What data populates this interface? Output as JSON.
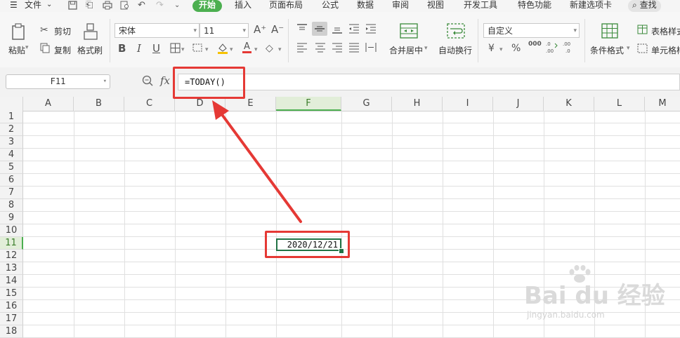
{
  "menubar": {
    "menu_icon": "hamburger-icon",
    "file_label": "文件",
    "tabs": [
      {
        "label": "开始",
        "active": true
      },
      {
        "label": "插入"
      },
      {
        "label": "页面布局"
      },
      {
        "label": "公式"
      },
      {
        "label": "数据"
      },
      {
        "label": "审阅"
      },
      {
        "label": "视图"
      },
      {
        "label": "开发工具"
      },
      {
        "label": "特色功能"
      },
      {
        "label": "新建选项卡"
      }
    ],
    "search_label": "查找"
  },
  "ribbon": {
    "paste_label": "粘贴",
    "cut_label": "剪切",
    "copy_label": "复制",
    "format_painter_label": "格式刷",
    "font_name": "宋体",
    "font_size": "11",
    "bold": "B",
    "italic": "I",
    "underline": "U",
    "merge_center_label": "合并居中",
    "wrap_text_label": "自动换行",
    "number_format": "自定义",
    "currency_symbol": "¥",
    "percent_symbol": "%",
    "thousands_symbol": "000",
    "conditional_format_label": "条件格式",
    "table_style_label": "表格样式",
    "cell_style_label": "单元格样式"
  },
  "formula_bar": {
    "name_box": "F11",
    "fx_label": "fx",
    "formula": "=TODAY()"
  },
  "sheet": {
    "columns": [
      "A",
      "B",
      "C",
      "D",
      "E",
      "F",
      "G",
      "H",
      "I",
      "J",
      "K",
      "L",
      "M"
    ],
    "rows": [
      "1",
      "2",
      "3",
      "4",
      "5",
      "6",
      "7",
      "8",
      "9",
      "10",
      "11",
      "12",
      "13",
      "14",
      "15",
      "16",
      "17",
      "18"
    ],
    "selected_column": "F",
    "selected_row": "11",
    "active_cell_value": "2020/12/21"
  },
  "annotations": {
    "color": "#e53935",
    "accent_green": "#4caf50"
  },
  "watermark": {
    "brand": "Bai du 经验",
    "url": "jingyan.baidu.com"
  }
}
